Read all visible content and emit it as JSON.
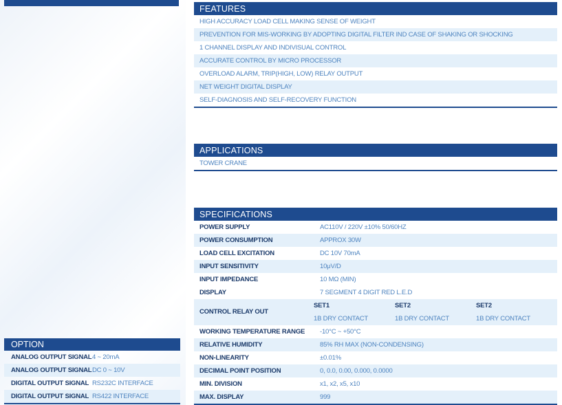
{
  "features": {
    "title": "FEATURES",
    "items": [
      "HIGH ACCURACY LOAD CELL MAKING SENSE OF WEIGHT",
      "PREVENTION FOR MIS-WORKING BY ADOPTING DIGITAL FILTER IND CASE OF SHAKING OR SHOCKING",
      "1 CHANNEL DISPLAY AND INDIVISUAL CONTROL",
      "ACCURATE CONTROL BY MICRO PROCESSOR",
      "OVERLOAD ALARM, TRIP(HIGH, LOW) RELAY OUTPUT",
      "NET WEIGHT DIGITAL DISPLAY",
      "SELF-DIAGNOSIS AND SELF-RECOVERY FUNCTION"
    ]
  },
  "applications": {
    "title": "APPLICATIONS",
    "items": [
      "TOWER CRANE"
    ]
  },
  "specifications": {
    "title": "SPECIFICATIONS",
    "rows_top": [
      {
        "label": "POWER SUPPLY",
        "value": "AC110V / 220V ±10% 50/60HZ"
      },
      {
        "label": "POWER CONSUMPTION",
        "value": "APPROX 30W"
      },
      {
        "label": "LOAD CELL EXCITATION",
        "value": "DC 10V 70mA"
      },
      {
        "label": "INPUT SENSITIVITY",
        "value": "10μV/D"
      },
      {
        "label": "INPUT IMPEDANCE",
        "value": "10 MΩ (MIN)"
      },
      {
        "label": "DISPLAY",
        "value": "7 SEGMENT 4 DIGIT RED L.E.D"
      }
    ],
    "relay": {
      "label": "CONTROL RELAY OUT",
      "sets": [
        {
          "name": "SET1",
          "contact": "1B DRY CONTACT"
        },
        {
          "name": "SET2",
          "contact": "1B DRY CONTACT"
        },
        {
          "name": "SET2",
          "contact": "1B DRY CONTACT"
        }
      ]
    },
    "rows_bottom": [
      {
        "label": "WORKING TEMPERATURE RANGE",
        "value": "-10°C ~ +50°C"
      },
      {
        "label": "RELATIVE HUMIDITY",
        "value": "85% RH MAX (NON-CONDENSING)"
      },
      {
        "label": "NON-LINEARITY",
        "value": "±0.01%"
      },
      {
        "label": "DECIMAL POINT POSITION",
        "value": "0, 0.0, 0.00, 0.000, 0.0000"
      },
      {
        "label": "MIN. DIVISION",
        "value": "x1, x2, x5, x10"
      },
      {
        "label": "MAX. DISPLAY",
        "value": "999"
      }
    ]
  },
  "option": {
    "title": "OPTION",
    "rows": [
      {
        "label": "ANALOG OUTPUT SIGNAL",
        "value": "4 ~ 20mA"
      },
      {
        "label": "ANALOG OUTPUT SIGNAL",
        "value": "DC 0 ~ 10V"
      },
      {
        "label": "DIGITAL OUTPUT SIGNAL",
        "value": "RS232C INTERFACE"
      },
      {
        "label": "DIGITAL OUTPUT SIGNAL",
        "value": "RS422 INTERFACE"
      }
    ]
  }
}
